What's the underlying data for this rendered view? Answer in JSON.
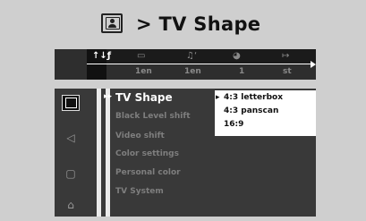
{
  "header": {
    "title": "> TV Shape",
    "icon": "picture-setup-icon"
  },
  "top_tabs": {
    "icons": [
      {
        "name": "general-setup-icon",
        "glyph": "↑↓ƒ",
        "active": true
      },
      {
        "name": "subtitle-icon",
        "glyph": "▭",
        "active": false
      },
      {
        "name": "audio-language-icon",
        "glyph": "♫‘",
        "active": false
      },
      {
        "name": "angle-icon",
        "glyph": "◕",
        "active": false
      },
      {
        "name": "playback-icon",
        "glyph": "↦",
        "active": false
      }
    ],
    "values": [
      "1en",
      "1en",
      "1",
      "st"
    ]
  },
  "side_icons": [
    {
      "name": "picture-setup-icon",
      "glyph": "",
      "active": true
    },
    {
      "name": "speaker-icon",
      "glyph": "◁",
      "active": false
    },
    {
      "name": "speech-bubble-icon",
      "glyph": "▢",
      "active": false
    },
    {
      "name": "lock-icon",
      "glyph": "⌂",
      "active": false
    }
  ],
  "menu": {
    "selected_marker": "▸▸",
    "items": [
      {
        "label": "TV Shape",
        "selected": true
      },
      {
        "label": "Black Level shift",
        "selected": false
      },
      {
        "label": "Video shift",
        "selected": false
      },
      {
        "label": "Color settings",
        "selected": false
      },
      {
        "label": "Personal color",
        "selected": false
      },
      {
        "label": "TV System",
        "selected": false
      }
    ]
  },
  "submenu": {
    "marker": "▸",
    "options": [
      "4:3 letterbox",
      "4:3 panscan",
      "16:9"
    ],
    "selected_index": 0
  },
  "colors": {
    "background": "#cfcfcf",
    "panel": "#393939",
    "strip": "#2e2e2e",
    "selected_text": "#ffffff",
    "inactive_text": "#7e7e7e",
    "submenu_bg": "#ffffff"
  }
}
